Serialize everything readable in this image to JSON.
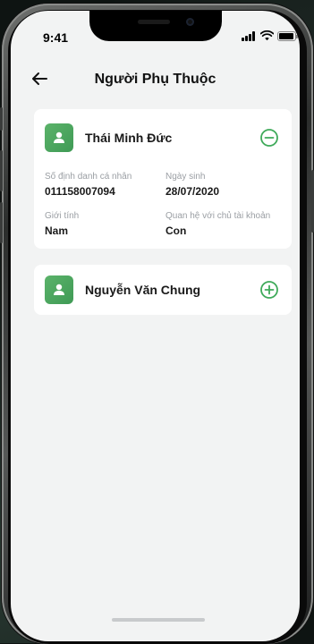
{
  "status_bar": {
    "time": "9:41",
    "icons": [
      "signal-icon",
      "wifi-icon",
      "battery-icon"
    ]
  },
  "header": {
    "title": "Người Phụ Thuộc",
    "back_icon": "arrow-left-icon"
  },
  "dependents": [
    {
      "name": "Thái Minh Đức",
      "expanded": true,
      "toggle_icon": "minus-circle-icon",
      "fields": {
        "id_label": "Số định danh cá nhân",
        "id_value": "011158007094",
        "dob_label": "Ngày sinh",
        "dob_value": "28/07/2020",
        "gender_label": "Giới tính",
        "gender_value": "Nam",
        "relation_label": "Quan hệ với chủ tài khoản",
        "relation_value": "Con"
      }
    },
    {
      "name": "Nguyễn Văn Chung",
      "expanded": false,
      "toggle_icon": "plus-circle-icon"
    }
  ],
  "colors": {
    "accent": "#3faa5a",
    "avatar_bg": "#4aa860",
    "screen_bg": "#f2f3f3",
    "label_text": "#9a9ea3"
  }
}
